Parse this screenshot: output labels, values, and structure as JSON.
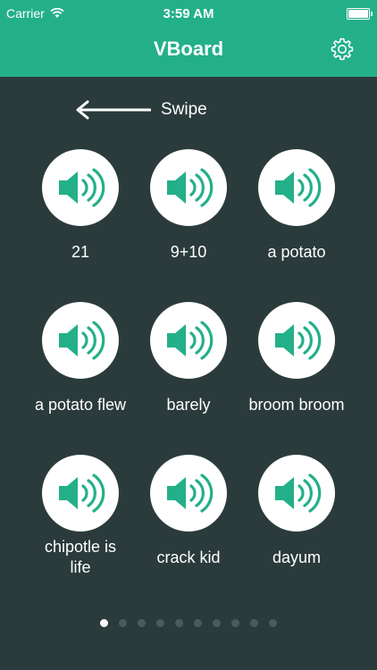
{
  "status_bar": {
    "carrier": "Carrier",
    "time": "3:59 AM",
    "battery_percent": 100
  },
  "header": {
    "title": "VBoard"
  },
  "hint": {
    "label": "Swipe"
  },
  "sounds": [
    {
      "label": "21"
    },
    {
      "label": "9+10"
    },
    {
      "label": "a potato"
    },
    {
      "label": "a potato flew"
    },
    {
      "label": "barely"
    },
    {
      "label": "broom broom"
    },
    {
      "label": "chipotle is life"
    },
    {
      "label": "crack kid"
    },
    {
      "label": "dayum"
    }
  ],
  "pager": {
    "total": 10,
    "current": 1
  },
  "colors": {
    "accent": "#23b089",
    "background": "#2b3b3b",
    "dot_inactive": "#4a5b5b"
  },
  "icons": {
    "settings": "gear-icon",
    "sound": "speaker-icon",
    "swipe": "arrow-left-icon",
    "wifi": "wifi-icon"
  }
}
